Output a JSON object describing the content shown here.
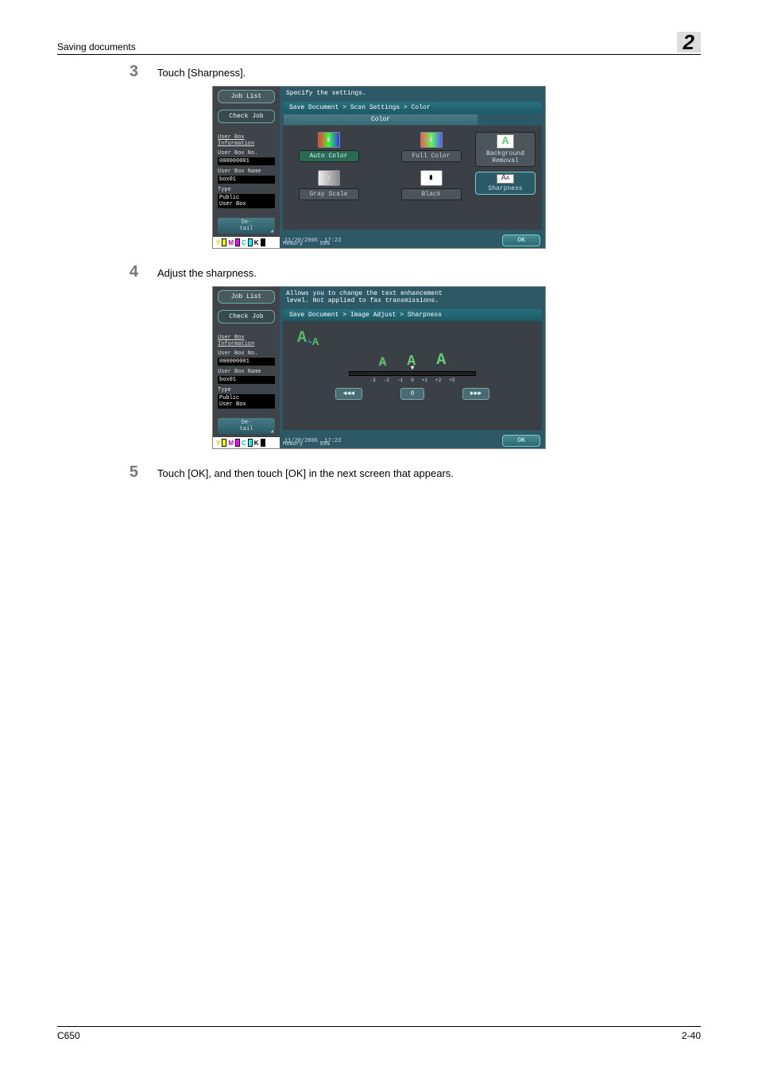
{
  "header": {
    "section": "Saving documents",
    "chapter": "2"
  },
  "steps": {
    "s3": {
      "num": "3",
      "text": "Touch [Sharpness]."
    },
    "s4": {
      "num": "4",
      "text": "Adjust the sharpness."
    },
    "s5": {
      "num": "5",
      "text": "Touch [OK], and then touch [OK] in the next screen that appears."
    }
  },
  "shot1": {
    "job_list": "Job List",
    "check_job": "Check Job",
    "heading": "Specify the settings.",
    "breadcrumb": "Save Document > Scan Settings > Color",
    "tab": "Color",
    "info": {
      "title": "User Box\nInformation",
      "no_label": "User Box No.",
      "no_val": "000000001",
      "name_label": "User Box Name",
      "name_val": "box01",
      "type_label": "Type",
      "type_val": "Public\nUser Box"
    },
    "detail": "De-\ntail",
    "options": {
      "auto": "Auto Color",
      "full": "Full Color",
      "gray": "Gray Scale",
      "black": "Black"
    },
    "side": {
      "bg": "Background\nRemoval",
      "sharp": "Sharpness"
    },
    "footer": {
      "date": "11/20/2006",
      "time": "17:22",
      "mem_label": "Memory",
      "mem_val": "99%",
      "ok": "OK"
    },
    "toner": {
      "y": "Y",
      "m": "M",
      "c": "C",
      "k": "K"
    }
  },
  "shot2": {
    "job_list": "Job List",
    "check_job": "Check Job",
    "heading": "Allows you to change the text enhancement\nlevel. Not applied to fax transmissions.",
    "breadcrumb": "Save Document > Image Adjust > Sharpness",
    "info": {
      "title": "User Box\nInformation",
      "no_label": "User Box No.",
      "no_val": "000000001",
      "name_label": "User Box Name",
      "name_val": "box01",
      "type_label": "Type",
      "type_val": "Public\nUser Box"
    },
    "detail": "De-\ntail",
    "scale": {
      "left_btn": "◄◄◄",
      "right_btn": "►►►",
      "center": "0",
      "ticks": [
        "-3",
        "-2",
        "-1",
        "0",
        "+1",
        "+2",
        "+3"
      ]
    },
    "footer": {
      "date": "11/20/2006",
      "time": "17:22",
      "mem_label": "Memory",
      "mem_val": "99%",
      "ok": "OK"
    },
    "toner": {
      "y": "Y",
      "m": "M",
      "c": "C",
      "k": "K"
    }
  },
  "footer": {
    "model": "C650",
    "page": "2-40"
  }
}
